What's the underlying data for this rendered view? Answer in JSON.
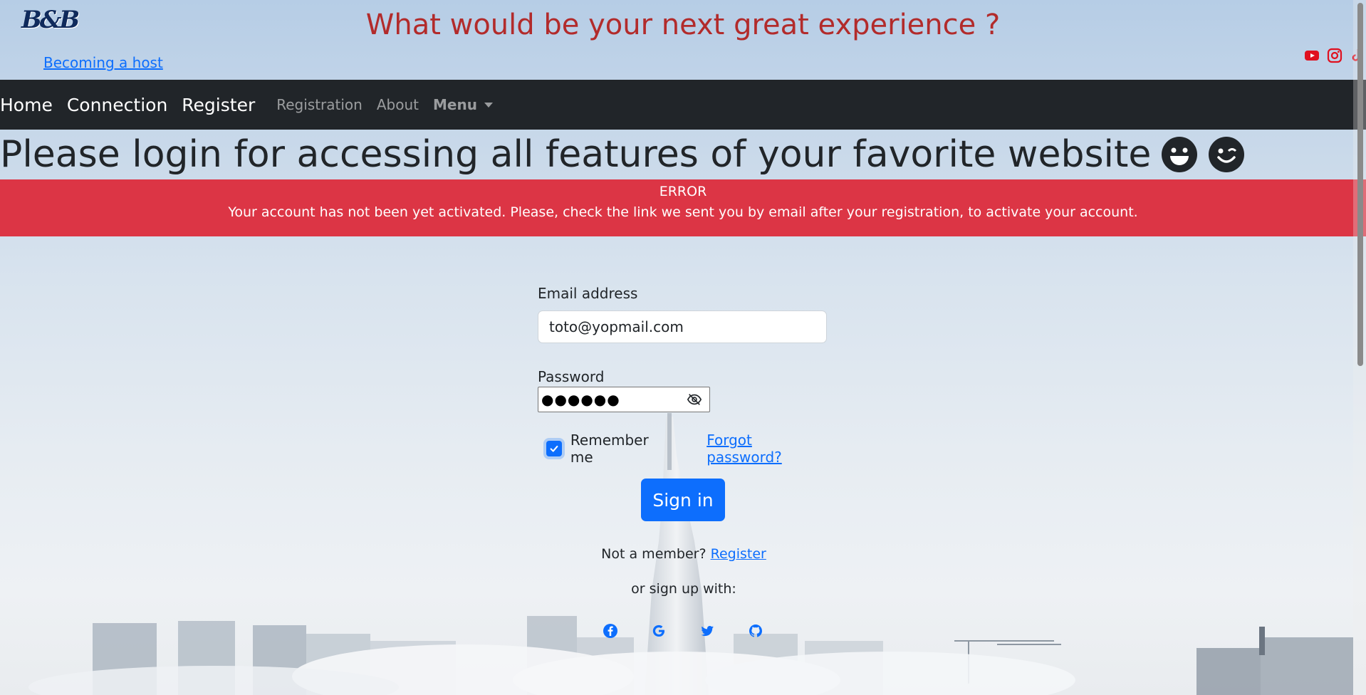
{
  "header": {
    "logo_text": "B&B",
    "host_link": "Becoming a host",
    "tagline": "What would be your next great experience ?",
    "social_icons": [
      "youtube-icon",
      "instagram-icon",
      "tiktok-icon"
    ],
    "social_color": "#e0101f"
  },
  "navbar": {
    "main_items": [
      "Home",
      "Connection",
      "Register"
    ],
    "sub_items": [
      "Registration",
      "About"
    ],
    "menu_label": "Menu",
    "background": "#212529"
  },
  "heading": {
    "text": "Please login for accessing all features of your favorite website",
    "emojis": [
      "grinning-face-icon",
      "winking-face-icon"
    ]
  },
  "alert": {
    "title": "ERROR",
    "message": "Your account has not been yet activated. Please, check the link we sent you by email after your registration, to activate your account.",
    "color": "#dc3545"
  },
  "form": {
    "email_label": "Email address",
    "email_value": "toto@yopmail.com",
    "password_label": "Password",
    "password_masked": "●●●●●●",
    "remember_label": "Remember me",
    "remember_checked": true,
    "forgot_link": "Forgot password?",
    "signin_label": "Sign in",
    "not_member_text": "Not a member?",
    "register_link": "Register",
    "signup_with_text": "or sign up with:",
    "signup_icons": [
      "facebook-icon",
      "google-icon",
      "twitter-icon",
      "github-icon"
    ],
    "accent": "#0d6efd"
  }
}
